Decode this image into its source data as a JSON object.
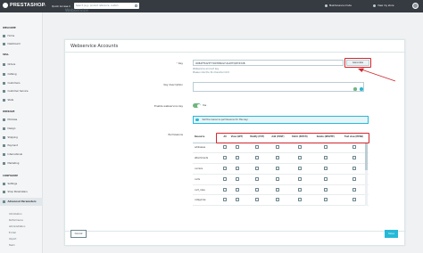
{
  "topbar": {
    "logo": "PRESTASHOP",
    "version": "8.0.1",
    "quick_access": "Quick Access ▾",
    "search_placeholder": "Search (e.g.: product reference, custom",
    "maintenance": "Maintenance mode",
    "view_store": "View my store"
  },
  "sidebar": {
    "sections": [
      {
        "title": "WELCOME",
        "items": [
          "Home",
          "Dashboard"
        ]
      },
      {
        "title": "SELL",
        "items": [
          "Orders",
          "Catalog",
          "Customers",
          "Customer Service",
          "Stats"
        ]
      },
      {
        "title": "IMPROVE",
        "items": [
          "Modules",
          "Design",
          "Shipping",
          "Payment",
          "International",
          "Marketing"
        ]
      },
      {
        "title": "CONFIGURE",
        "items": [
          "Settings",
          "Shop Parameters",
          "Advanced Parameters"
        ]
      }
    ],
    "subitems": [
      "Information",
      "Performance",
      "Administration",
      "E-mail",
      "Import",
      "Team"
    ]
  },
  "page": {
    "title": "Webservice"
  },
  "form": {
    "title": "Webservice Accounts",
    "key_label": "Key",
    "key_value": "9DB4FFKAHF7YRKTPRKGYUG2HFQMYZ3UB",
    "generate_label": "Generate",
    "key_help_1": "Webservice account key.",
    "key_help_2": "Please note the 32-character limit",
    "desc_label": "Key description",
    "enable_label": "Enable webservice key",
    "enable_value": "Yes",
    "permissions_label": "Permissions",
    "alert_text": "Set the resource permissions for this key:",
    "table_headers": [
      "Resource",
      "All",
      "View (GET)",
      "Modify (PUT)",
      "Add (POST)",
      "Patch (PATCH)",
      "Delete (DELETE)",
      "Fast view (HEAD)"
    ],
    "rows": [
      "addresses",
      "attachments",
      "carriers",
      "carts",
      "cart_rules",
      "categories"
    ],
    "cancel_label": "Cancel",
    "save_label": "Save"
  }
}
